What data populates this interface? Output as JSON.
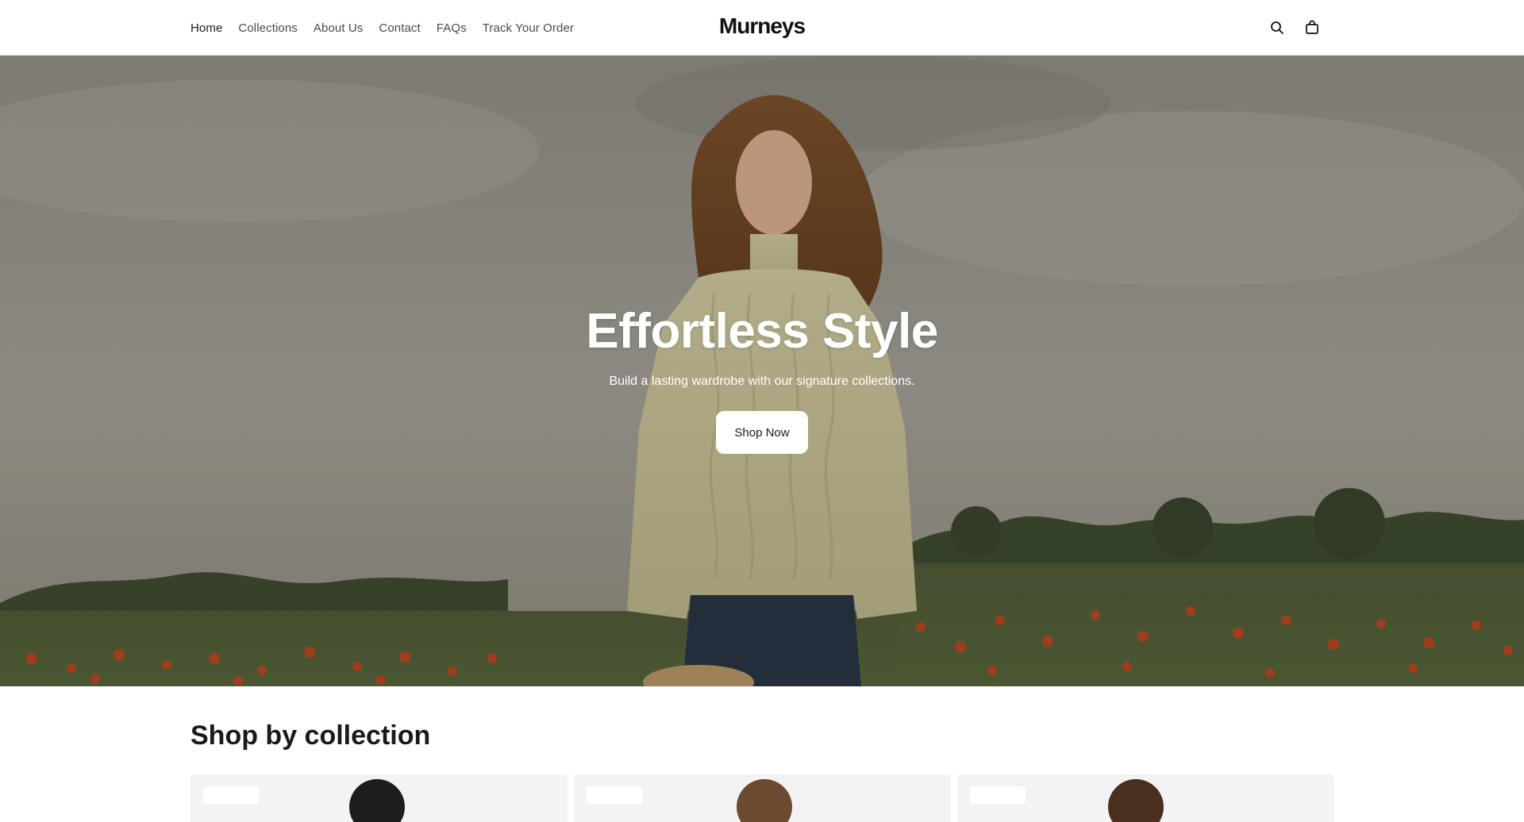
{
  "header": {
    "brand": "Murneys",
    "nav": [
      {
        "label": "Home",
        "active": true
      },
      {
        "label": "Collections"
      },
      {
        "label": "About Us"
      },
      {
        "label": "Contact"
      },
      {
        "label": "FAQs"
      },
      {
        "label": "Track Your Order"
      }
    ],
    "icons": [
      "search-icon",
      "shopping-bag-icon"
    ]
  },
  "hero": {
    "title": "Effortless Style",
    "subtitle": "Build a lasting wardrobe with our signature collections.",
    "cta_label": "Shop Now"
  },
  "collections": {
    "heading": "Shop by collection",
    "card_count": 3
  },
  "colors": {
    "text": "#1a1a1a",
    "nav_text": "#4a4a4a",
    "button_bg": "#ffffff",
    "card_bg": "#f3f3f3"
  }
}
